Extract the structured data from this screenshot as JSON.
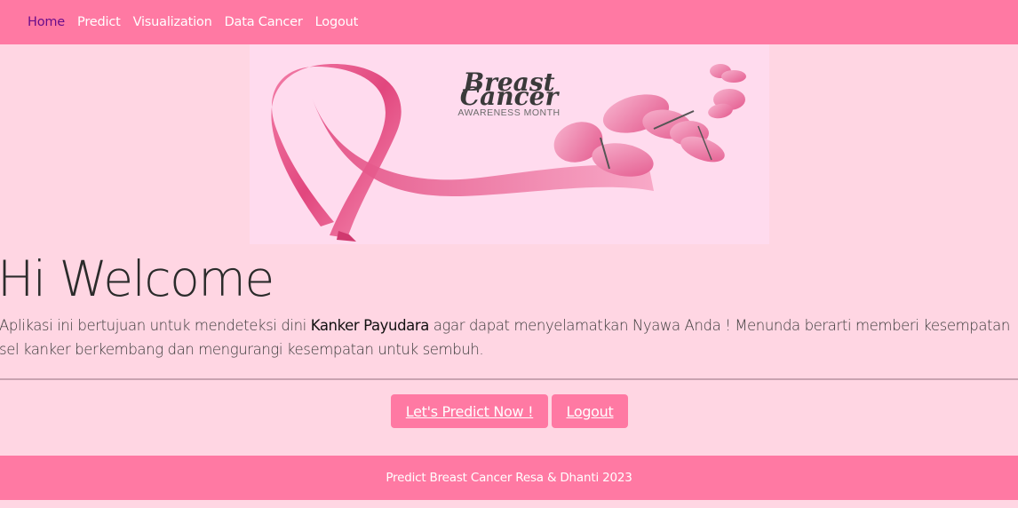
{
  "nav": {
    "items": [
      {
        "label": "Home",
        "active": true
      },
      {
        "label": "Predict"
      },
      {
        "label": "Visualization"
      },
      {
        "label": "Data Cancer"
      },
      {
        "label": "Logout"
      }
    ]
  },
  "banner": {
    "title_line1": "Breast",
    "title_line2": "Cancer",
    "subtitle": "AWARENESS MONTH"
  },
  "main": {
    "welcome_title": "Hi Welcome",
    "description_part1": "Aplikasi ini bertujuan untuk mendeteksi dini ",
    "description_bold": "Kanker Payudara",
    "description_part2": " agar dapat menyelamatkan Nyawa Anda ! Menunda berarti memberi kesempatan sel kanker berkembang dan mengurangi kesempatan untuk sembuh."
  },
  "buttons": {
    "predict_label": "Let's Predict Now !",
    "logout_label": "Logout"
  },
  "footer": {
    "text": "Predict Breast Cancer Resa & Dhanti 2023"
  },
  "colors": {
    "navbar": "#ff79a3",
    "background": "#ffd6e3",
    "active_nav": "#6a0d8a",
    "banner_bg": "#ffdbee",
    "ribbon": "#e8447c"
  }
}
